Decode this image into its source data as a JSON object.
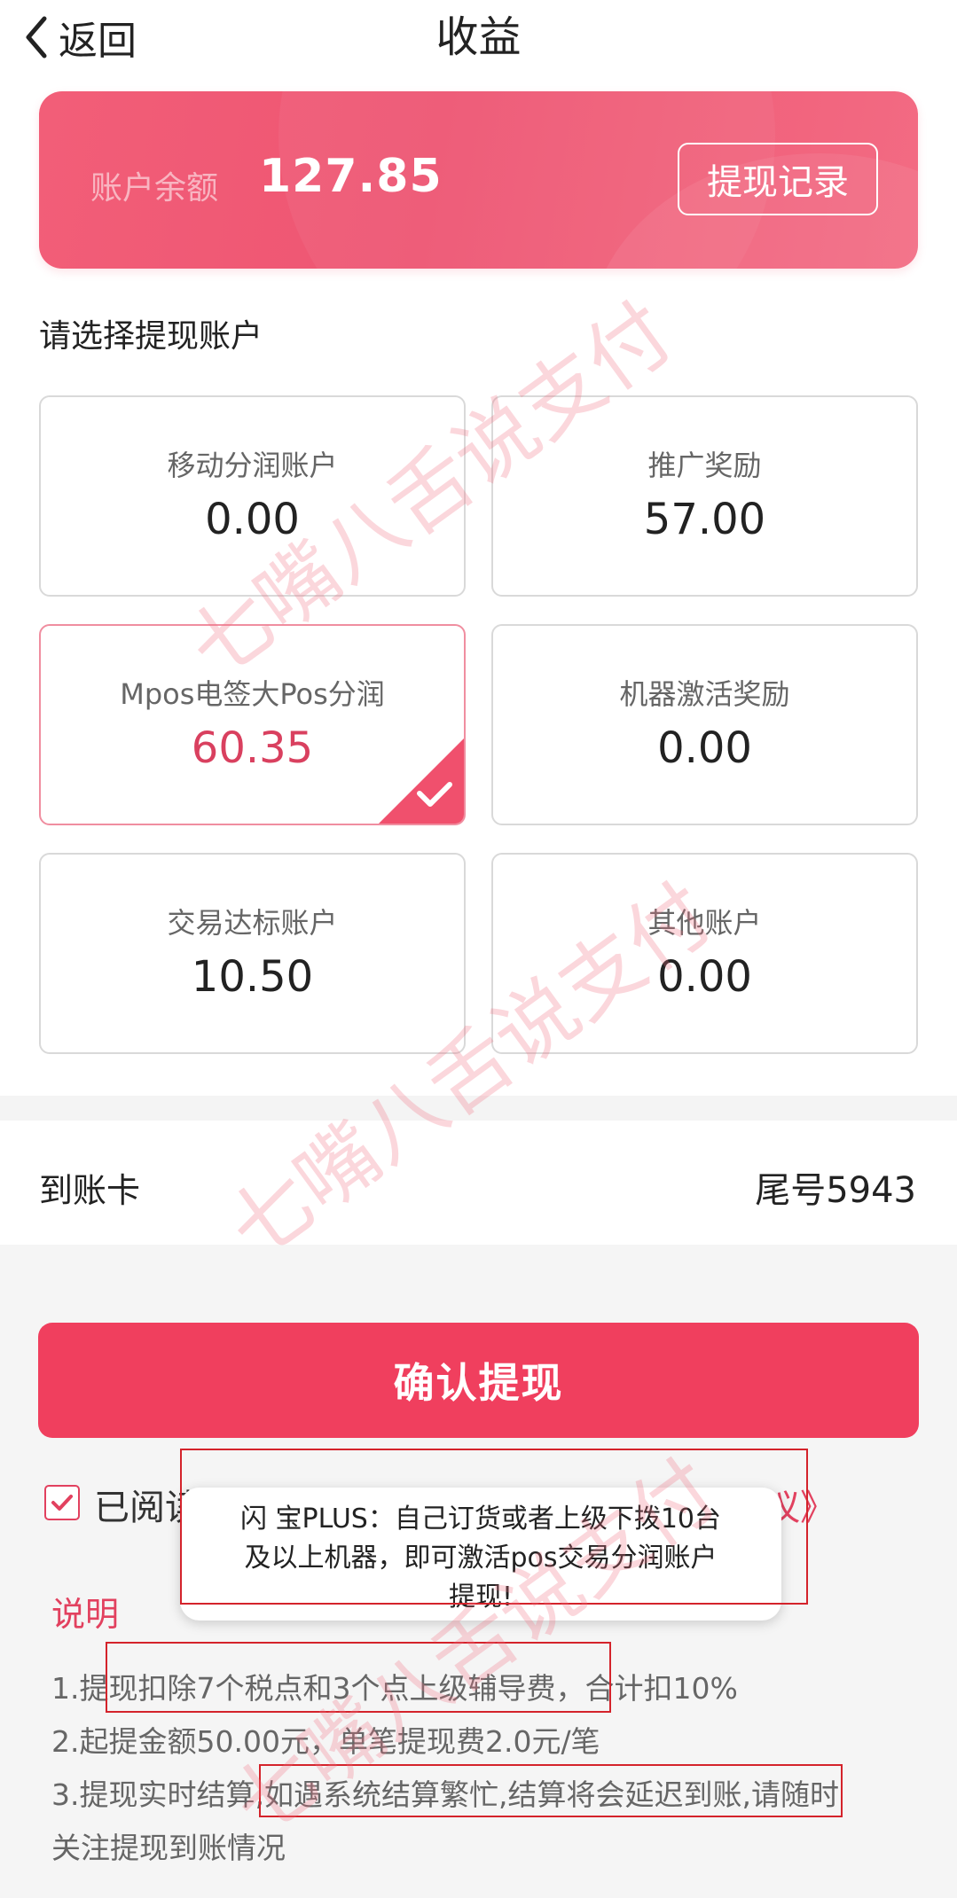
{
  "header": {
    "back_label": "返回",
    "title": "收益"
  },
  "balance": {
    "label": "账户余额",
    "value": "127.85",
    "record_button": "提现记录"
  },
  "section_label": "请选择提现账户",
  "accounts": [
    {
      "name": "移动分润账户",
      "value": "0.00",
      "selected": false
    },
    {
      "name": "推广奖励",
      "value": "57.00",
      "selected": false
    },
    {
      "name": "Mpos电签大Pos分润",
      "value": "60.35",
      "selected": true
    },
    {
      "name": "机器激活奖励",
      "value": "0.00",
      "selected": false
    },
    {
      "name": "交易达标账户",
      "value": "10.50",
      "selected": false
    },
    {
      "name": "其他账户",
      "value": "0.00",
      "selected": false
    }
  ],
  "arrival_card": {
    "label": "到账卡",
    "tail": "尾号5943"
  },
  "confirm_button": "确认提现",
  "agreement": {
    "prefix": "已阅读",
    "link_suffix": "议》",
    "checked": true
  },
  "toast": {
    "line1": "闪 宝PLUS：自己订货或者上级下拨10台",
    "line2": "及以上机器，即可激活pos交易分润账户",
    "line3": "提现!"
  },
  "description": {
    "title": "说明",
    "lines": [
      "1.提现扣除7个税点和3个点上级辅导费，合计扣10%",
      "2.起提金额50.00元，单笔提现费2.0元/笔",
      "3.提现实时结算,如遇系统结算繁忙,结算将会延迟到账,请随时",
      "关注提现到账情况"
    ]
  },
  "watermark": "七嘴八舌说支付",
  "colors": {
    "accent": "#f03f5e",
    "card_gradient_start": "#f25e78",
    "selected_value": "#d9405f",
    "annotation_box": "#d4232b"
  }
}
